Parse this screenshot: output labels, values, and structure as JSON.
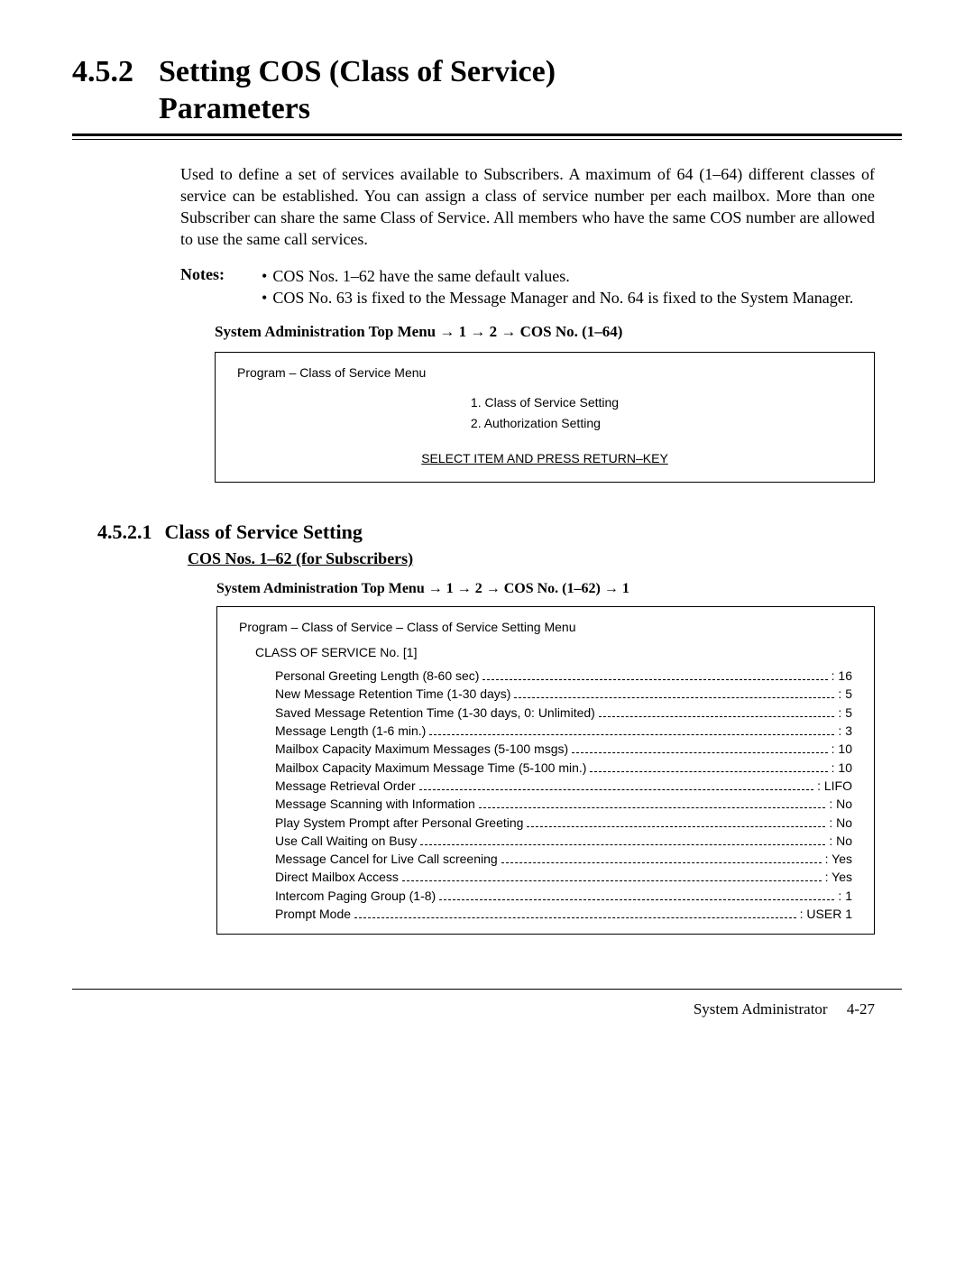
{
  "section": {
    "number": "4.5.2",
    "title_line1": "Setting COS (Class of Service)",
    "title_line2": "Parameters"
  },
  "intro": "Used to define a set of services available to Subscribers. A maximum of 64 (1–64) different classes of service can be established. You can assign a class of service number per each mailbox. More than one Subscriber can share the same Class of Service. All members who have the same COS number are allowed to use the same call services.",
  "notes": {
    "label": "Notes:",
    "items": [
      "COS Nos. 1–62 have the same default values.",
      "COS No. 63 is fixed to the Message Manager and No. 64 is fixed to the System Manager."
    ]
  },
  "nav_path1": "System Administration Top Menu → 1 → 2 → COS No. (1–64)",
  "menu_box": {
    "title": "Program – Class of Service Menu",
    "item1": "1. Class of Service Setting",
    "item2": "2. Authorization Setting",
    "prompt": "SELECT ITEM AND PRESS RETURN–KEY"
  },
  "subsection": {
    "number": "4.5.2.1",
    "title": "Class of Service Setting",
    "subtitle": "COS Nos. 1–62 (for Subscribers)"
  },
  "nav_path2": "System Administration Top Menu → 1 → 2 → COS No. (1–62) → 1",
  "setting_box": {
    "title": "Program – Class of Service – Class of Service Setting Menu",
    "cos_no": "CLASS OF SERVICE No. [1]",
    "rows": [
      {
        "label": "Personal Greeting Length (8-60 sec)",
        "value": ": 16"
      },
      {
        "label": "New Message Retention Time (1-30 days)",
        "value": ": 5"
      },
      {
        "label": "Saved Message Retention Time (1-30 days, 0: Unlimited)",
        "value": ": 5"
      },
      {
        "label": "Message Length (1-6 min.)",
        "value": ": 3"
      },
      {
        "label": "Mailbox Capacity Maximum Messages (5-100 msgs)",
        "value": ": 10"
      },
      {
        "label": "Mailbox Capacity Maximum Message Time (5-100 min.)",
        "value": ": 10"
      },
      {
        "label": "Message Retrieval Order",
        "value": ": LIFO"
      },
      {
        "label": "Message Scanning with Information",
        "value": ": No"
      },
      {
        "label": "Play System Prompt after Personal Greeting",
        "value": ": No"
      },
      {
        "label": "Use Call Waiting on Busy",
        "value": ": No"
      },
      {
        "label": "Message Cancel for Live Call screening",
        "value": ": Yes"
      },
      {
        "label": "Direct Mailbox Access",
        "value": ": Yes"
      },
      {
        "label": "Intercom Paging Group (1-8)",
        "value": ": 1"
      },
      {
        "label": "Prompt Mode",
        "value": ": USER 1"
      }
    ]
  },
  "footer": {
    "label": "System Administrator",
    "page": "4-27"
  }
}
